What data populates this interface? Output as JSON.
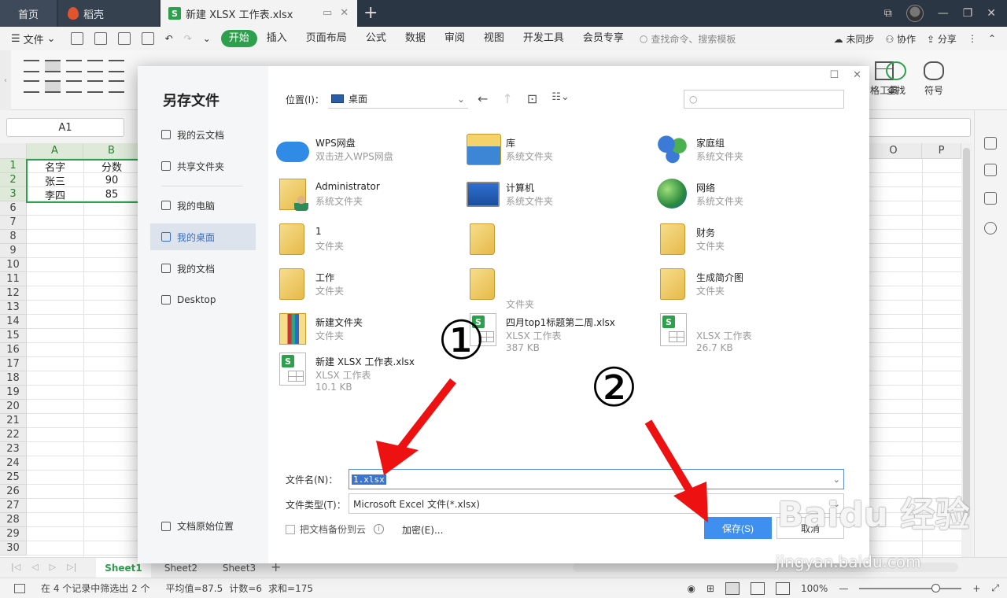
{
  "tabs": {
    "home": "首页",
    "daoke": "稻壳",
    "active": "新建 XLSX 工作表.xlsx",
    "active_icon": "S"
  },
  "menu": {
    "file": "文件",
    "tabs": [
      "开始",
      "插入",
      "页面布局",
      "公式",
      "数据",
      "审阅",
      "视图",
      "开发工具",
      "会员专享"
    ],
    "search": "查找命令、搜索模板",
    "right": [
      "未同步",
      "协作",
      "分享"
    ]
  },
  "ribbon": {
    "table_tools": "格工具",
    "find": "查找",
    "symbol": "符号"
  },
  "namebox": "A1",
  "sheet": {
    "columns": [
      "A",
      "B",
      "O",
      "P"
    ],
    "rows": [
      "1",
      "2",
      "3",
      "6",
      "7",
      "8",
      "9",
      "10",
      "11",
      "12",
      "13",
      "14",
      "15",
      "16",
      "17",
      "18",
      "19",
      "20",
      "21",
      "22",
      "23",
      "24",
      "25",
      "26",
      "27",
      "28",
      "29",
      "30"
    ],
    "cells": [
      [
        "名字",
        "分数"
      ],
      [
        "张三",
        "90"
      ],
      [
        "李四",
        "85"
      ]
    ]
  },
  "sheettabs": [
    "Sheet1",
    "Sheet2",
    "Sheet3"
  ],
  "status": {
    "filter": "在 4 个记录中筛选出 2 个",
    "avg": "平均值=87.5",
    "count": "计数=6",
    "sum": "求和=175",
    "zoom": "100%"
  },
  "dialog": {
    "title": "另存文件",
    "nav": [
      "我的云文档",
      "共享文件夹",
      "我的电脑",
      "我的桌面",
      "我的文档",
      "Desktop"
    ],
    "original_location": "文档原始位置",
    "location_label": "位置(I)：",
    "location_value": "桌面",
    "files": [
      {
        "name": "WPS网盘",
        "sub": "双击进入WPS网盘",
        "sub2": "",
        "icon": "cloud-icon"
      },
      {
        "name": "库",
        "sub": "系统文件夹",
        "sub2": "",
        "icon": "library-icon"
      },
      {
        "name": "家庭组",
        "sub": "系统文件夹",
        "sub2": "",
        "icon": "homegroup-icon"
      },
      {
        "name": "Administrator",
        "sub": "系统文件夹",
        "sub2": "",
        "icon": "user-folder-icon"
      },
      {
        "name": "计算机",
        "sub": "系统文件夹",
        "sub2": "",
        "icon": "computer-icon"
      },
      {
        "name": "网络",
        "sub": "系统文件夹",
        "sub2": "",
        "icon": "network-icon"
      },
      {
        "name": "1",
        "sub": "文件夹",
        "sub2": "",
        "icon": "folder-icon"
      },
      {
        "name": "",
        "sub": "",
        "sub2": "",
        "icon": "folder-icon"
      },
      {
        "name": "财务",
        "sub": "文件夹",
        "sub2": "",
        "icon": "folder-icon"
      },
      {
        "name": "工作",
        "sub": "文件夹",
        "sub2": "",
        "icon": "folder-icon"
      },
      {
        "name": "",
        "sub": "",
        "sub2": "文件夹",
        "icon": "folder-icon"
      },
      {
        "name": "生成简介图",
        "sub": "文件夹",
        "sub2": "",
        "icon": "folder-icon"
      },
      {
        "name": "新建文件夹",
        "sub": "文件夹",
        "sub2": "",
        "icon": "color-folder-icon"
      },
      {
        "name": "四月top1标题第二周.xlsx",
        "sub": "XLSX 工作表",
        "sub2": "387 KB",
        "icon": "xlsx-icon"
      },
      {
        "name": "",
        "sub": "XLSX 工作表",
        "sub2": "26.7 KB",
        "icon": "xlsx-icon"
      },
      {
        "name": "新建 XLSX 工作表.xlsx",
        "sub": "XLSX 工作表",
        "sub2": "10.1 KB",
        "icon": "xlsx-icon"
      }
    ],
    "filename_label": "文件名(N)：",
    "filename_value": "1.xlsx",
    "filetype_label": "文件类型(T)：",
    "filetype_value": "Microsoft Excel 文件(*.xlsx)",
    "backup_label": "把文档备份到云",
    "encrypt_label": "加密(E)...",
    "save_label": "保存(S)",
    "cancel_label": "取消"
  },
  "annotations": {
    "step1": "①",
    "step2": "②",
    "arrow_color": "#ee1111"
  },
  "watermark": {
    "logo": "Baidu 经验",
    "url": "jingyan.baidu.com"
  },
  "colors": {
    "wps_green": "#2e9f4d",
    "title_bar": "#2b3645",
    "save_button": "#3e8ff0",
    "selection_blue": "#3b74d1"
  }
}
